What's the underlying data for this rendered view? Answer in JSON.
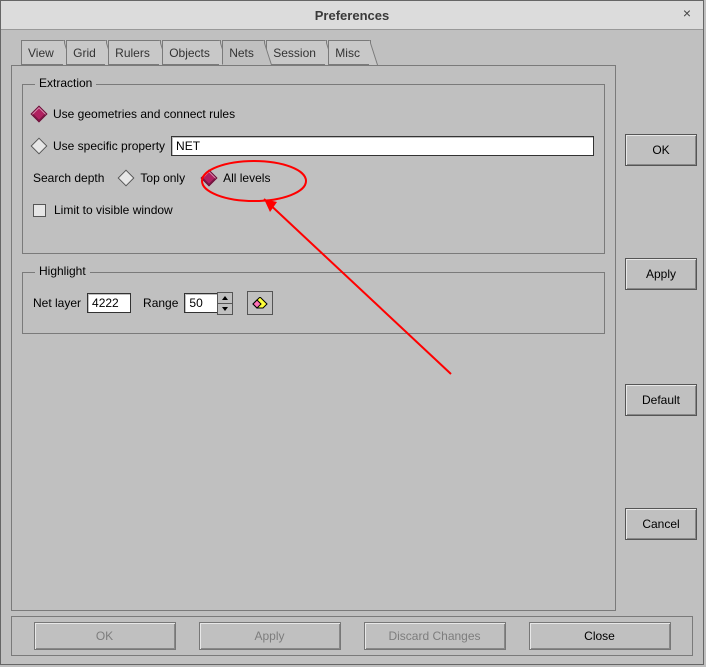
{
  "window": {
    "title": "Preferences",
    "close_glyph": "×"
  },
  "tabs": {
    "view": "View",
    "grid": "Grid",
    "rulers": "Rulers",
    "objects": "Objects",
    "nets": "Nets",
    "session": "Session",
    "misc": "Misc"
  },
  "extraction": {
    "legend": "Extraction",
    "geom_label": "Use geometries and connect rules",
    "prop_label": "Use specific property",
    "prop_value": "NET",
    "search_depth_label": "Search depth",
    "toponly_label": "Top only",
    "alllevels_label": "All levels",
    "limit_label": "Limit to visible window"
  },
  "highlight": {
    "legend": "Highlight",
    "netlayer_label": "Net layer",
    "netlayer_value": "4222",
    "range_label": "Range",
    "range_value": "50"
  },
  "side": {
    "ok": "OK",
    "apply": "Apply",
    "default": "Default",
    "cancel": "Cancel"
  },
  "bottom": {
    "ok": "OK",
    "apply": "Apply",
    "discard": "Discard Changes",
    "close": "Close"
  }
}
